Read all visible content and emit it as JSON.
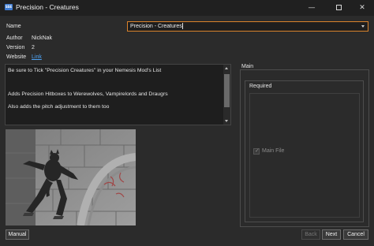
{
  "window": {
    "app_icon_text": "SSE",
    "title": "Precision - Creatures",
    "minimize_glyph": "—",
    "close_glyph": "✕",
    "icons": [
      "app-icon",
      "minimize-icon",
      "maximize-icon",
      "close-icon"
    ]
  },
  "fields": {
    "name_label": "Name",
    "name_value": "Precision - Creatures",
    "author_label": "Author",
    "author_value": "NickNak",
    "version_label": "Version",
    "version_value": "2",
    "website_label": "Website",
    "website_link": "Link"
  },
  "description": {
    "lines": [
      "Be sure to Tick \"Precision Creatures\" in your Nemesis Mod's List",
      "Adds Precision Hitboxes to Werewolves, Vampirelords and Draugrs",
      "Also adds the pitch adjustment to them too"
    ]
  },
  "groups": {
    "main_title": "Main",
    "required_title": "Required"
  },
  "options": {
    "main_file_label": "Main File",
    "main_file_checked": true,
    "main_file_enabled": false,
    "check_glyph": "✓"
  },
  "buttons": {
    "manual": "Manual",
    "back": "Back",
    "next": "Next",
    "cancel": "Cancel"
  },
  "colors": {
    "background": "#2b2b2b",
    "input_focus_border": "#d9822b",
    "link": "#4ea3f5",
    "disabled_text": "#8a8a8a"
  }
}
